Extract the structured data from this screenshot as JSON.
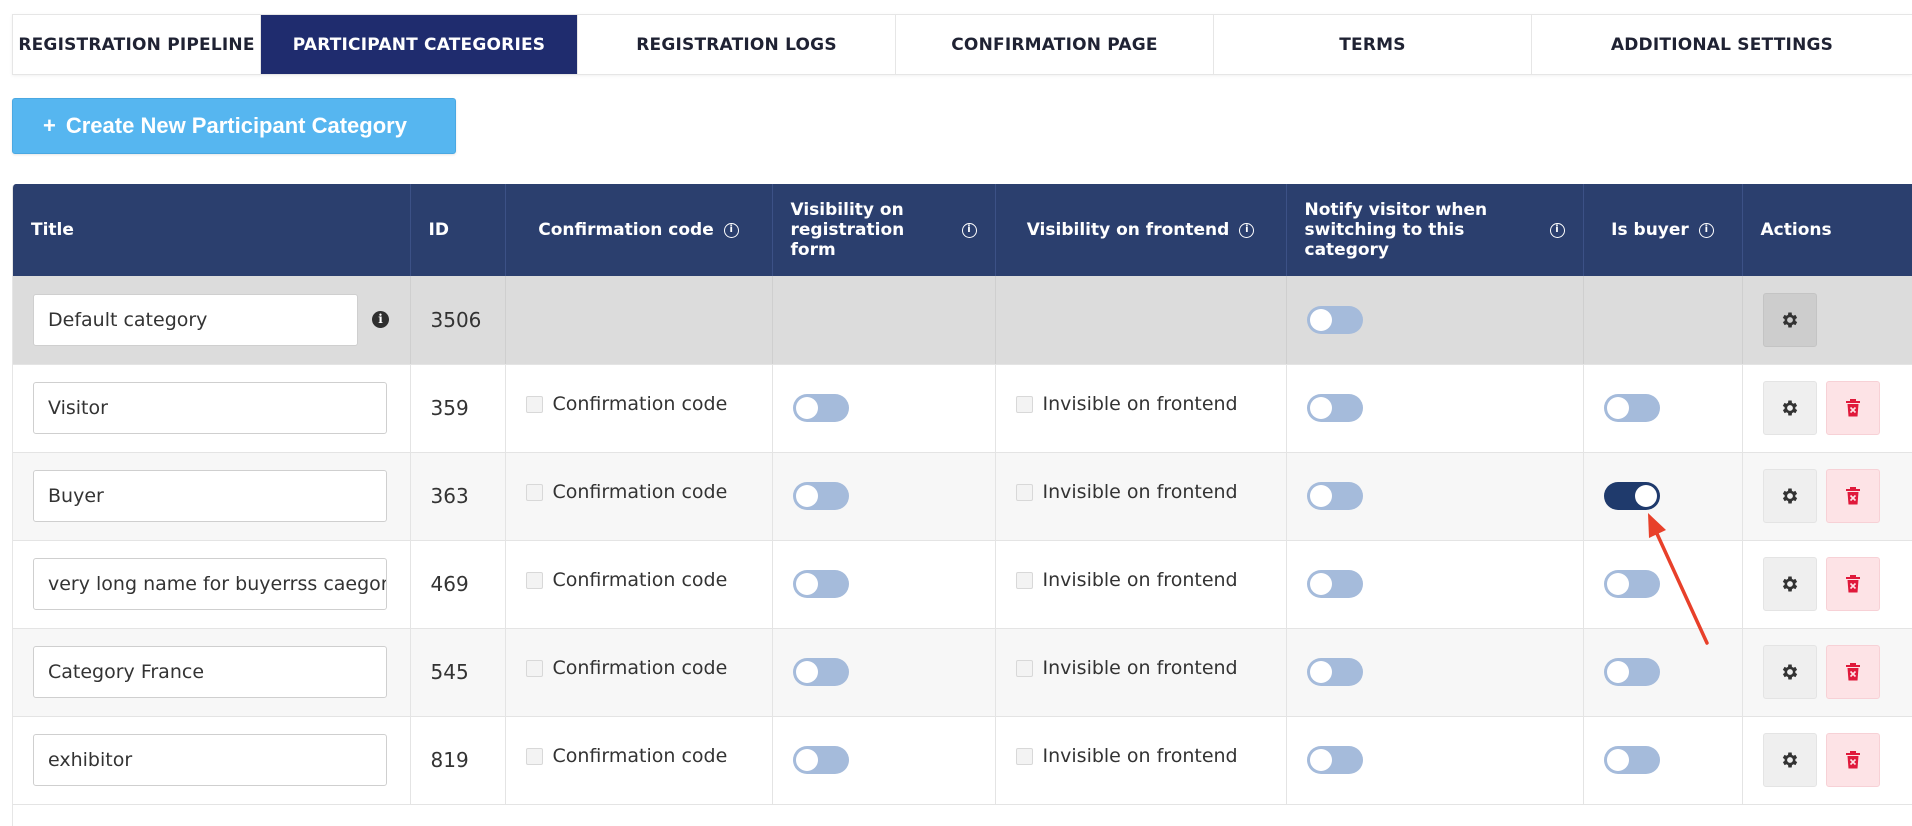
{
  "tabs": [
    {
      "label": "REGISTRATION PIPELINE",
      "active": false
    },
    {
      "label": "PARTICIPANT CATEGORIES",
      "active": true
    },
    {
      "label": "REGISTRATION LOGS",
      "active": false
    },
    {
      "label": "CONFIRMATION PAGE",
      "active": false
    },
    {
      "label": "TERMS",
      "active": false
    },
    {
      "label": "ADDITIONAL SETTINGS",
      "active": false
    }
  ],
  "create_button": {
    "plus": "+",
    "label": "Create New Participant Category"
  },
  "columns": {
    "title": "Title",
    "id": "ID",
    "confirmation_code": "Confirmation code",
    "visibility_registration": "Visibility on registration form",
    "visibility_frontend": "Visibility on frontend",
    "notify_visitor": "Notify visitor when switching to this category",
    "is_buyer": "Is buyer",
    "actions": "Actions"
  },
  "info_glyph": "i",
  "checkbox_labels": {
    "confirmation_code": "Confirmation code",
    "invisible_frontend": "Invisible on frontend"
  },
  "rows": [
    {
      "title": "Default category",
      "id": "3506",
      "default": true,
      "notify": false
    },
    {
      "title": "Visitor",
      "id": "359",
      "default": false,
      "registration_visible": false,
      "notify": false,
      "is_buyer": false
    },
    {
      "title": "Buyer",
      "id": "363",
      "default": false,
      "registration_visible": false,
      "notify": false,
      "is_buyer": true
    },
    {
      "title": "very long name for buyerrss caegor",
      "id": "469",
      "default": false,
      "registration_visible": false,
      "notify": false,
      "is_buyer": false
    },
    {
      "title": "Category France",
      "id": "545",
      "default": false,
      "registration_visible": false,
      "notify": false,
      "is_buyer": false
    },
    {
      "title": "exhibitor",
      "id": "819",
      "default": false,
      "registration_visible": false,
      "notify": false,
      "is_buyer": false
    }
  ],
  "colors": {
    "tab_active": "#1f2c6e",
    "header_bg": "#2b3f6e",
    "create_btn": "#56b6f0",
    "toggle_off": "#a5bbdb",
    "toggle_on": "#1f3a6c",
    "delete_icon": "#e0193b",
    "annotation_arrow": "#e8402a"
  }
}
